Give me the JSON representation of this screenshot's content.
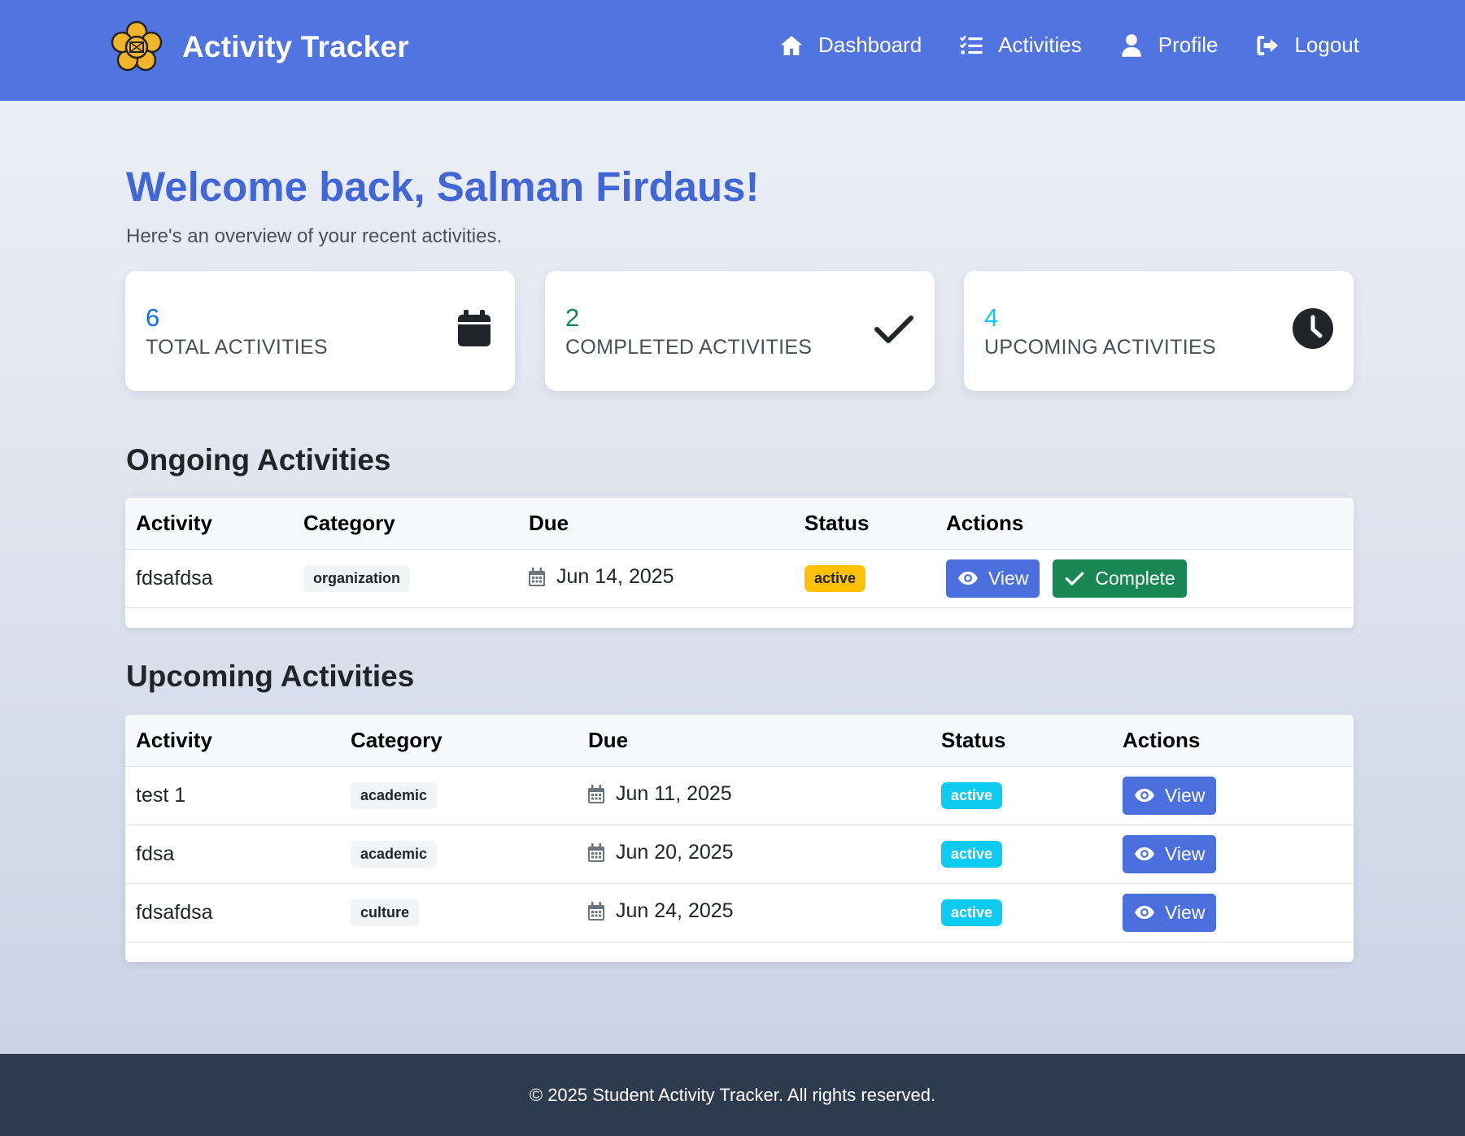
{
  "app": {
    "title": "Activity Tracker",
    "logo": "flower-emblem-icon"
  },
  "nav": [
    {
      "label": "Dashboard",
      "icon": "home-icon"
    },
    {
      "label": "Activities",
      "icon": "list-check-icon"
    },
    {
      "label": "Profile",
      "icon": "user-icon"
    },
    {
      "label": "Logout",
      "icon": "logout-icon"
    }
  ],
  "header": {
    "welcome": "Welcome back, Salman Firdaus!",
    "subtitle": "Here's an overview of your recent activities."
  },
  "stats": [
    {
      "value": "6",
      "label": "TOTAL ACTIVITIES",
      "color": "#0d6efd",
      "icon": "calendar-icon"
    },
    {
      "value": "2",
      "label": "COMPLETED ACTIVITIES",
      "color": "#198754",
      "icon": "check-icon"
    },
    {
      "value": "4",
      "label": "UPCOMING ACTIVITIES",
      "color": "#0dcaf0",
      "icon": "clock-icon"
    }
  ],
  "ongoing": {
    "title": "Ongoing Activities",
    "columns": [
      "Activity",
      "Category",
      "Due",
      "Status",
      "Actions"
    ],
    "rows": [
      {
        "activity": "fdsafdsa",
        "category": "organization",
        "due": "Jun 14, 2025",
        "status": "active",
        "view": "View",
        "complete": "Complete"
      }
    ]
  },
  "upcoming": {
    "title": "Upcoming Activities",
    "columns": [
      "Activity",
      "Category",
      "Due",
      "Status",
      "Actions"
    ],
    "rows": [
      {
        "activity": "test 1",
        "category": "academic",
        "due": "Jun 11, 2025",
        "status": "active",
        "view": "View"
      },
      {
        "activity": "fdsa",
        "category": "academic",
        "due": "Jun 20, 2025",
        "status": "active",
        "view": "View"
      },
      {
        "activity": "fdsafdsa",
        "category": "culture",
        "due": "Jun 24, 2025",
        "status": "active",
        "view": "View"
      }
    ]
  },
  "footer": {
    "text": "© 2025 Student Activity Tracker. All rights reserved."
  },
  "colors": {
    "navbar": "#5175e0",
    "accent": "#4366d6",
    "view_button": "#4c6fe0",
    "complete_button": "#198754",
    "footer": "#2d3b4e"
  }
}
